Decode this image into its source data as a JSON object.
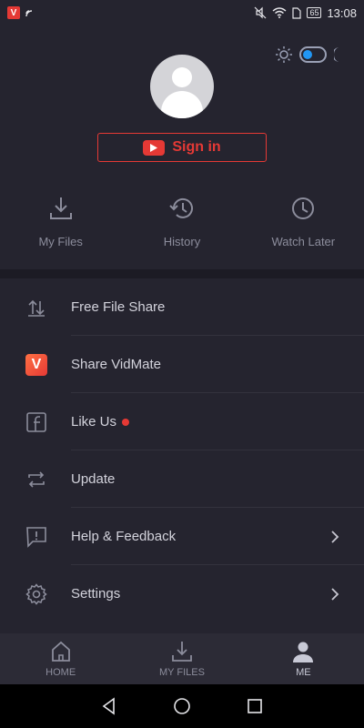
{
  "status_bar": {
    "time": "13:08",
    "battery": "65"
  },
  "signin": {
    "label": "Sign in"
  },
  "quick_actions": [
    {
      "label": "My Files",
      "icon": "download-icon"
    },
    {
      "label": "History",
      "icon": "history-icon"
    },
    {
      "label": "Watch Later",
      "icon": "clock-icon"
    }
  ],
  "menu": [
    {
      "label": "Free File Share",
      "icon": "file-share-icon"
    },
    {
      "label": "Share VidMate",
      "icon": "vidmate-logo-icon"
    },
    {
      "label": "Like Us",
      "icon": "facebook-icon",
      "badge": true
    },
    {
      "label": "Update",
      "icon": "update-icon"
    },
    {
      "label": "Help & Feedback",
      "icon": "feedback-icon",
      "chevron": true
    },
    {
      "label": "Settings",
      "icon": "gear-icon",
      "chevron": true
    }
  ],
  "bottom_nav": [
    {
      "label": "HOME",
      "icon": "home-icon"
    },
    {
      "label": "MY FILES",
      "icon": "download-icon"
    },
    {
      "label": "ME",
      "icon": "person-icon",
      "active": true
    }
  ],
  "colors": {
    "accent": "#e53935",
    "toggle": "#2196f3",
    "background": "#25242f"
  }
}
